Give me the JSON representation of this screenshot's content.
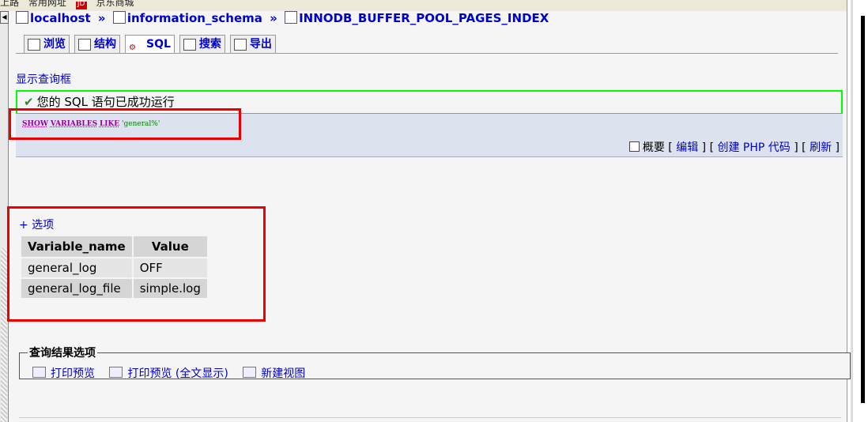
{
  "topbar": {
    "items": [
      "上路",
      "常用网址",
      "京东商城"
    ]
  },
  "breadcrumb": {
    "host": "localhost",
    "db": "information_schema",
    "table": "INNODB_BUFFER_POOL_PAGES_INDEX",
    "sep": "»"
  },
  "tabs": [
    {
      "label": "浏览",
      "icon": "browse-icon"
    },
    {
      "label": "结构",
      "icon": "structure-icon"
    },
    {
      "label": "SQL",
      "icon": "sql-icon",
      "active": true
    },
    {
      "label": "搜索",
      "icon": "search-icon"
    },
    {
      "label": "导出",
      "icon": "export-icon"
    }
  ],
  "show_query_box": "显示查询框",
  "success_message": "您的 SQL 语句已成功运行",
  "sql": {
    "kw1": "SHOW",
    "kw2": "VARIABLES",
    "kw3": "LIKE",
    "str": "'general%'"
  },
  "sql_actions": {
    "profiling": "概要",
    "edit": "编辑",
    "create_php": "创建 PHP 代码",
    "refresh": "刷新"
  },
  "options_link": "+ 选项",
  "results": {
    "columns": [
      "Variable_name",
      "Value"
    ],
    "rows": [
      [
        "general_log",
        "OFF"
      ],
      [
        "general_log_file",
        "simple.log"
      ]
    ]
  },
  "query_results_ops": {
    "legend": "查询结果选项",
    "print_view": "打印预览",
    "print_view_full": "打印预览 (全文显示)",
    "create_view": "新建视图"
  },
  "colors": {
    "link": "#0000cc",
    "highlight_red": "#ee0000",
    "success_border": "#00ff00"
  }
}
